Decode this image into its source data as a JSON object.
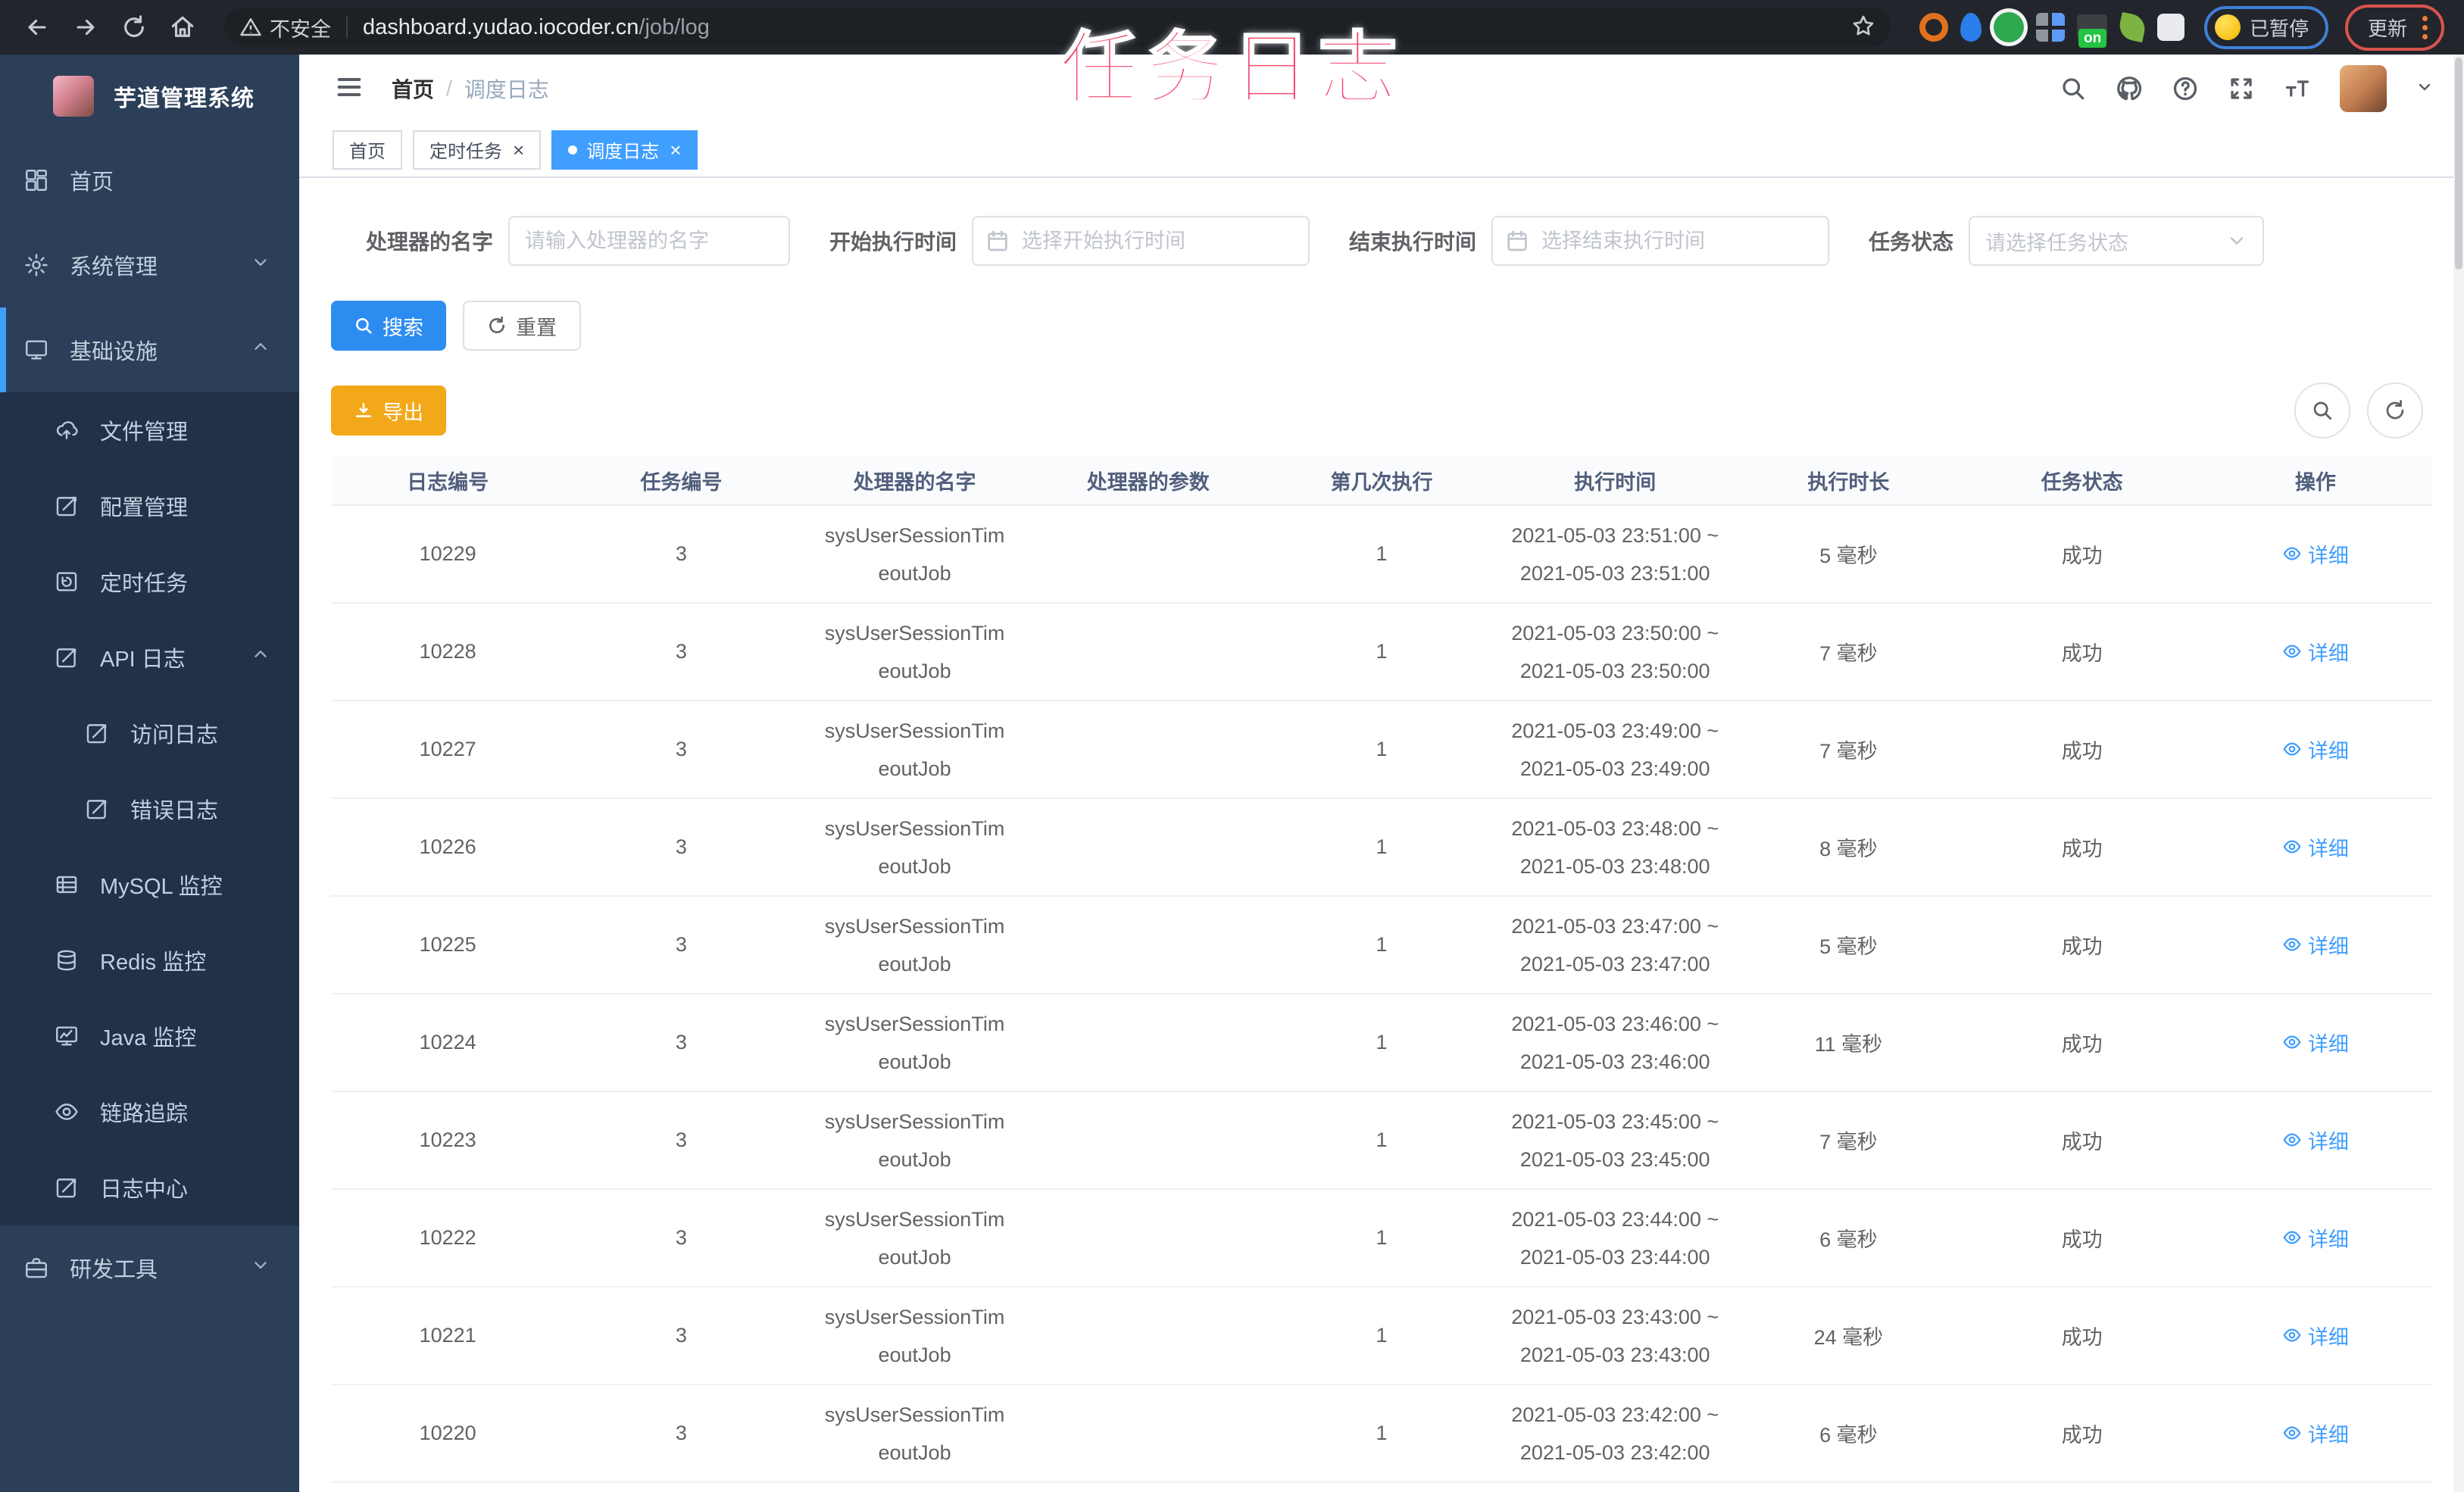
{
  "overlay_title": "任务日志",
  "browser": {
    "security_label": "不安全",
    "url_host": "dashboard.yudao.iocoder.cn",
    "url_path": "/job/log",
    "extensions": [
      "orange-ring",
      "blue-drop",
      "green-badge",
      "grid",
      "proxy-on",
      "leaf",
      "puzzle"
    ],
    "proxy_on_label": "on",
    "paused_label": "已暂停",
    "update_label": "更新"
  },
  "sidebar": {
    "app_title": "芋道管理系统",
    "items": [
      {
        "label": "首页",
        "icon": "dashboard-icon",
        "level": 1
      },
      {
        "label": "系统管理",
        "icon": "gear-icon",
        "level": 1,
        "arrow": "down"
      },
      {
        "label": "基础设施",
        "icon": "monitor-icon",
        "level": 1,
        "arrow": "up",
        "active": true
      },
      {
        "label": "文件管理",
        "icon": "upload-cloud-icon",
        "level": 2
      },
      {
        "label": "配置管理",
        "icon": "edit-icon",
        "level": 2
      },
      {
        "label": "定时任务",
        "icon": "timer-icon",
        "level": 2
      },
      {
        "label": "API 日志",
        "icon": "log-icon",
        "level": 2,
        "arrow": "up"
      },
      {
        "label": "访问日志",
        "icon": "log-icon",
        "level": 3
      },
      {
        "label": "错误日志",
        "icon": "log-icon",
        "level": 3
      },
      {
        "label": "MySQL 监控",
        "icon": "database-icon",
        "level": 2
      },
      {
        "label": "Redis 监控",
        "icon": "redis-icon",
        "level": 2
      },
      {
        "label": "Java 监控",
        "icon": "java-icon",
        "level": 2
      },
      {
        "label": "链路追踪",
        "icon": "eye-icon",
        "level": 2
      },
      {
        "label": "日志中心",
        "icon": "log-icon",
        "level": 2
      },
      {
        "label": "研发工具",
        "icon": "toolbox-icon",
        "level": 1,
        "arrow": "down"
      }
    ]
  },
  "topbar": {
    "breadcrumb_home": "首页",
    "breadcrumb_current": "调度日志"
  },
  "tabs": [
    {
      "label": "首页",
      "closable": false,
      "active": false
    },
    {
      "label": "定时任务",
      "closable": true,
      "active": false
    },
    {
      "label": "调度日志",
      "closable": true,
      "active": true
    }
  ],
  "filters": {
    "name_label": "处理器的名字",
    "name_placeholder": "请输入处理器的名字",
    "begin_label": "开始执行时间",
    "begin_placeholder": "选择开始执行时间",
    "end_label": "结束执行时间",
    "end_placeholder": "选择结束执行时间",
    "status_label": "任务状态",
    "status_placeholder": "请选择任务状态",
    "search_label": "搜索",
    "reset_label": "重置"
  },
  "toolbar": {
    "export_label": "导出"
  },
  "table": {
    "columns": [
      "日志编号",
      "任务编号",
      "处理器的名字",
      "处理器的参数",
      "第几次执行",
      "执行时间",
      "执行时长",
      "任务状态",
      "操作"
    ],
    "rows": [
      {
        "log_id": "10229",
        "job_id": "3",
        "handler1": "sysUserSessionTim",
        "handler2": "eoutJob",
        "param": "",
        "times": "1",
        "time1": "2021-05-03 23:51:00 ~",
        "time2": "2021-05-03 23:51:00",
        "duration": "5 毫秒",
        "status": "成功",
        "action": "详细"
      },
      {
        "log_id": "10228",
        "job_id": "3",
        "handler1": "sysUserSessionTim",
        "handler2": "eoutJob",
        "param": "",
        "times": "1",
        "time1": "2021-05-03 23:50:00 ~",
        "time2": "2021-05-03 23:50:00",
        "duration": "7 毫秒",
        "status": "成功",
        "action": "详细"
      },
      {
        "log_id": "10227",
        "job_id": "3",
        "handler1": "sysUserSessionTim",
        "handler2": "eoutJob",
        "param": "",
        "times": "1",
        "time1": "2021-05-03 23:49:00 ~",
        "time2": "2021-05-03 23:49:00",
        "duration": "7 毫秒",
        "status": "成功",
        "action": "详细"
      },
      {
        "log_id": "10226",
        "job_id": "3",
        "handler1": "sysUserSessionTim",
        "handler2": "eoutJob",
        "param": "",
        "times": "1",
        "time1": "2021-05-03 23:48:00 ~",
        "time2": "2021-05-03 23:48:00",
        "duration": "8 毫秒",
        "status": "成功",
        "action": "详细"
      },
      {
        "log_id": "10225",
        "job_id": "3",
        "handler1": "sysUserSessionTim",
        "handler2": "eoutJob",
        "param": "",
        "times": "1",
        "time1": "2021-05-03 23:47:00 ~",
        "time2": "2021-05-03 23:47:00",
        "duration": "5 毫秒",
        "status": "成功",
        "action": "详细"
      },
      {
        "log_id": "10224",
        "job_id": "3",
        "handler1": "sysUserSessionTim",
        "handler2": "eoutJob",
        "param": "",
        "times": "1",
        "time1": "2021-05-03 23:46:00 ~",
        "time2": "2021-05-03 23:46:00",
        "duration": "11 毫秒",
        "status": "成功",
        "action": "详细"
      },
      {
        "log_id": "10223",
        "job_id": "3",
        "handler1": "sysUserSessionTim",
        "handler2": "eoutJob",
        "param": "",
        "times": "1",
        "time1": "2021-05-03 23:45:00 ~",
        "time2": "2021-05-03 23:45:00",
        "duration": "7 毫秒",
        "status": "成功",
        "action": "详细"
      },
      {
        "log_id": "10222",
        "job_id": "3",
        "handler1": "sysUserSessionTim",
        "handler2": "eoutJob",
        "param": "",
        "times": "1",
        "time1": "2021-05-03 23:44:00 ~",
        "time2": "2021-05-03 23:44:00",
        "duration": "6 毫秒",
        "status": "成功",
        "action": "详细"
      },
      {
        "log_id": "10221",
        "job_id": "3",
        "handler1": "sysUserSessionTim",
        "handler2": "eoutJob",
        "param": "",
        "times": "1",
        "time1": "2021-05-03 23:43:00 ~",
        "time2": "2021-05-03 23:43:00",
        "duration": "24 毫秒",
        "status": "成功",
        "action": "详细"
      },
      {
        "log_id": "10220",
        "job_id": "3",
        "handler1": "sysUserSessionTim",
        "handler2": "eoutJob",
        "param": "",
        "times": "1",
        "time1": "2021-05-03 23:42:00 ~",
        "time2": "2021-05-03 23:42:00",
        "duration": "6 毫秒",
        "status": "成功",
        "action": "详细"
      }
    ]
  }
}
